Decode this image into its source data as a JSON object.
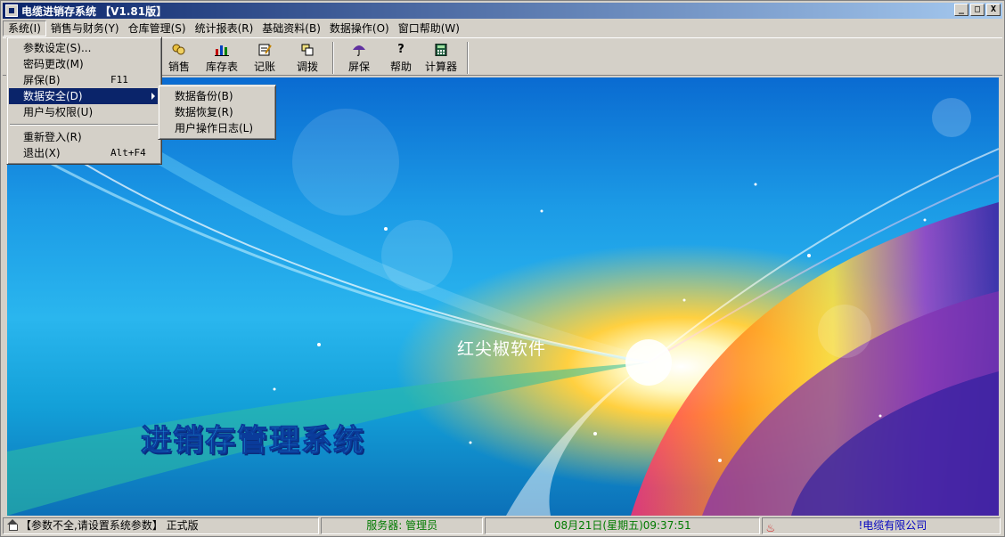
{
  "window": {
    "title": "电缆进销存系统 【V1.81版】",
    "buttons": {
      "minimize": "_",
      "maximize": "□",
      "close": "X"
    }
  },
  "menubar": [
    "系统(I)",
    "销售与财务(Y)",
    "仓库管理(S)",
    "统计报表(R)",
    "基础资料(B)",
    "数据操作(O)",
    "窗口帮助(W)"
  ],
  "system_menu": {
    "items": [
      {
        "label": "参数设定(S)...",
        "shortcut": ""
      },
      {
        "label": "密码更改(M)",
        "shortcut": ""
      },
      {
        "label": "屏保(B)",
        "shortcut": "F11"
      },
      {
        "label": "数据安全(D)",
        "shortcut": "",
        "submenu": true
      },
      {
        "label": "用户与权限(U)",
        "shortcut": ""
      },
      {
        "label": "重新登入(R)",
        "shortcut": ""
      },
      {
        "label": "退出(X)",
        "shortcut": "Alt+F4"
      }
    ]
  },
  "data_security_submenu": {
    "items": [
      "数据备份(B)",
      "数据恢复(R)",
      "用户操作日志(L)"
    ]
  },
  "toolbar": {
    "buttons": [
      {
        "label": "销售",
        "icon": "sales-icon"
      },
      {
        "label": "库存表",
        "icon": "inventory-chart-icon"
      },
      {
        "label": "记账",
        "icon": "ledger-icon"
      },
      {
        "label": "调拨",
        "icon": "transfer-icon"
      },
      {
        "label": "屏保",
        "icon": "umbrella-icon"
      },
      {
        "label": "帮助",
        "icon": "help-icon"
      },
      {
        "label": "计算器",
        "icon": "calculator-icon"
      }
    ]
  },
  "main": {
    "center_text": "红尖椒软件",
    "system_title": "进销存管理系统"
  },
  "statusbar": {
    "message": "【参数不全,请设置系统参数】 正式版",
    "server": "服务器: 管理员",
    "datetime": "08月21日(星期五)09:37:51",
    "company": "!电缆有限公司",
    "colors": {
      "server": "#007a00",
      "datetime": "#007a00",
      "company": "#0000c0"
    }
  }
}
